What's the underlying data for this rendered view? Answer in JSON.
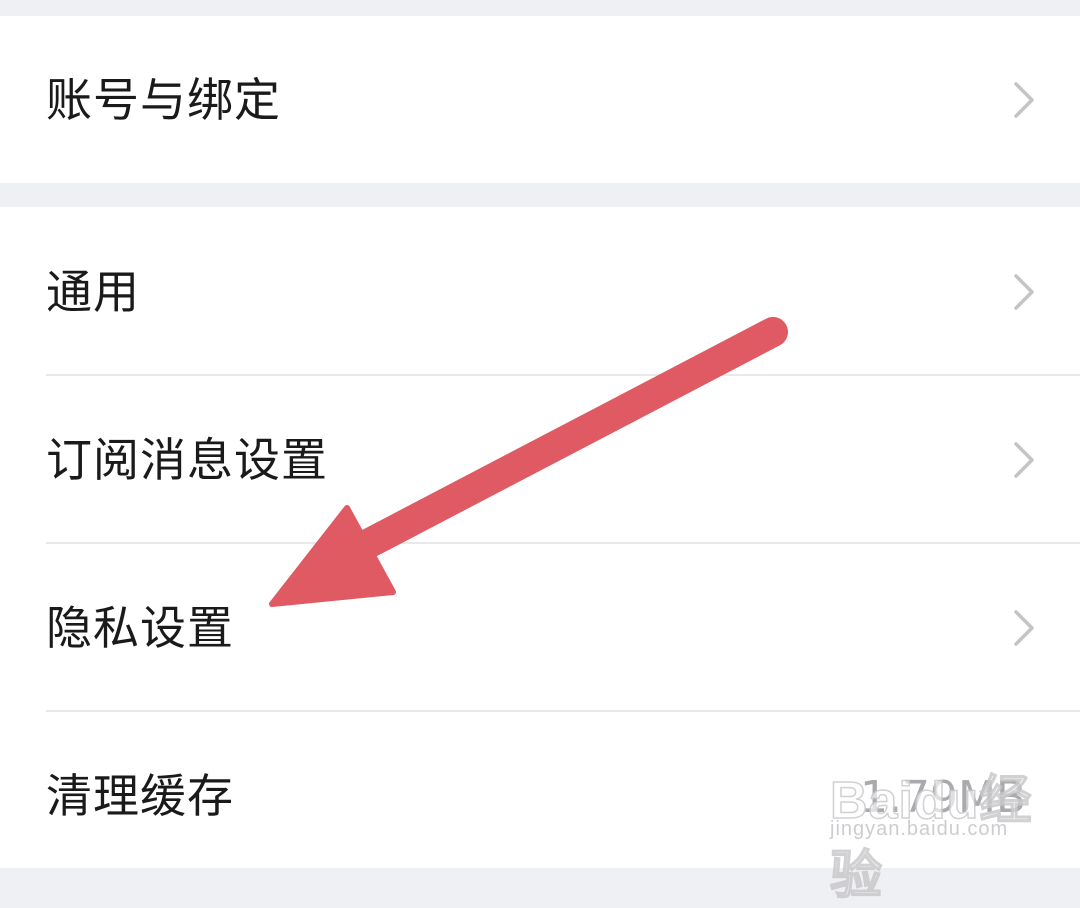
{
  "settings": {
    "account": {
      "label": "账号与绑定"
    },
    "general": {
      "label": "通用"
    },
    "subscription": {
      "label": "订阅消息设置"
    },
    "privacy": {
      "label": "隐私设置"
    },
    "cache": {
      "label": "清理缓存",
      "value": "1.79MB"
    }
  },
  "watermark": {
    "brand": "Baidu经验",
    "url": "jingyan.baidu.com"
  },
  "colors": {
    "background": "#eff0f4",
    "row_background": "#ffffff",
    "text": "#1a1a1a",
    "chevron": "#c4c4c8",
    "annotation_arrow": "#e05a64"
  },
  "icons": {
    "chevron": "chevron-right-icon",
    "annotation": "red-arrow-annotation"
  }
}
